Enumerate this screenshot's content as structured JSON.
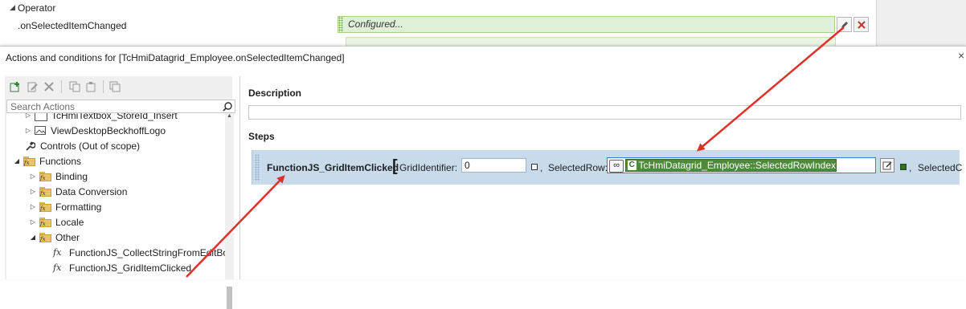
{
  "property_grid": {
    "group_label": "Operator",
    "event_name": ".onSelectedItemChanged",
    "event_value": "Configured..."
  },
  "dialog": {
    "title": "Actions and conditions for [TcHmiDatagrid_Employee.onSelectedItemChanged]",
    "close_glyph": "×"
  },
  "toolbar": {
    "icons": [
      "add-icon",
      "edit-icon",
      "delete-icon",
      "copy-icon",
      "paste-icon",
      "duplicate-icon"
    ]
  },
  "search": {
    "placeholder": "Search Actions"
  },
  "tree": {
    "items": [
      {
        "label": "TcHmiTextbox_StoreId_Insert",
        "level": 1,
        "icon": "component-icon"
      },
      {
        "label": "ViewDesktopBeckhoffLogo",
        "level": 1,
        "icon": "image-icon"
      },
      {
        "label": "Controls (Out of scope)",
        "level": 0,
        "icon": "wrench-icon"
      },
      {
        "label": "Functions",
        "level": 0,
        "icon": "function-folder-icon",
        "expanded": true
      },
      {
        "label": "Binding",
        "level": 1,
        "icon": "function-folder-icon"
      },
      {
        "label": "Data Conversion",
        "level": 1,
        "icon": "function-folder-icon"
      },
      {
        "label": "Formatting",
        "level": 1,
        "icon": "function-folder-icon"
      },
      {
        "label": "Locale",
        "level": 1,
        "icon": "function-folder-icon"
      },
      {
        "label": "Other",
        "level": 1,
        "icon": "function-folder-icon",
        "expanded": true
      },
      {
        "label": "FunctionJS_CollectStringFromEditBo",
        "level": 2,
        "icon": "fx-icon"
      },
      {
        "label": "FunctionJS_GridItemClicked",
        "level": 2,
        "icon": "fx-icon"
      }
    ]
  },
  "right": {
    "description_label": "Description",
    "description_value": "",
    "steps_label": "Steps"
  },
  "step": {
    "function_name": "FunctionJS_GridItemClicked",
    "bracket": "[",
    "param1_label": "GridIdentifier:",
    "param1_value": "0",
    "comma": ",",
    "param2_label": "SelectedRow:",
    "param2_symbol_badge": "C",
    "param2_symbol": "TcHmiDatagrid_Employee::SelectedRowIndex",
    "param3_label": "SelectedC"
  },
  "colors": {
    "configured_bg": "#dff0d8",
    "step_bg": "#c9dbea",
    "symbol_bg": "#4f8a3c",
    "arrow": "#e0302a",
    "delete_red": "#c0392b"
  }
}
